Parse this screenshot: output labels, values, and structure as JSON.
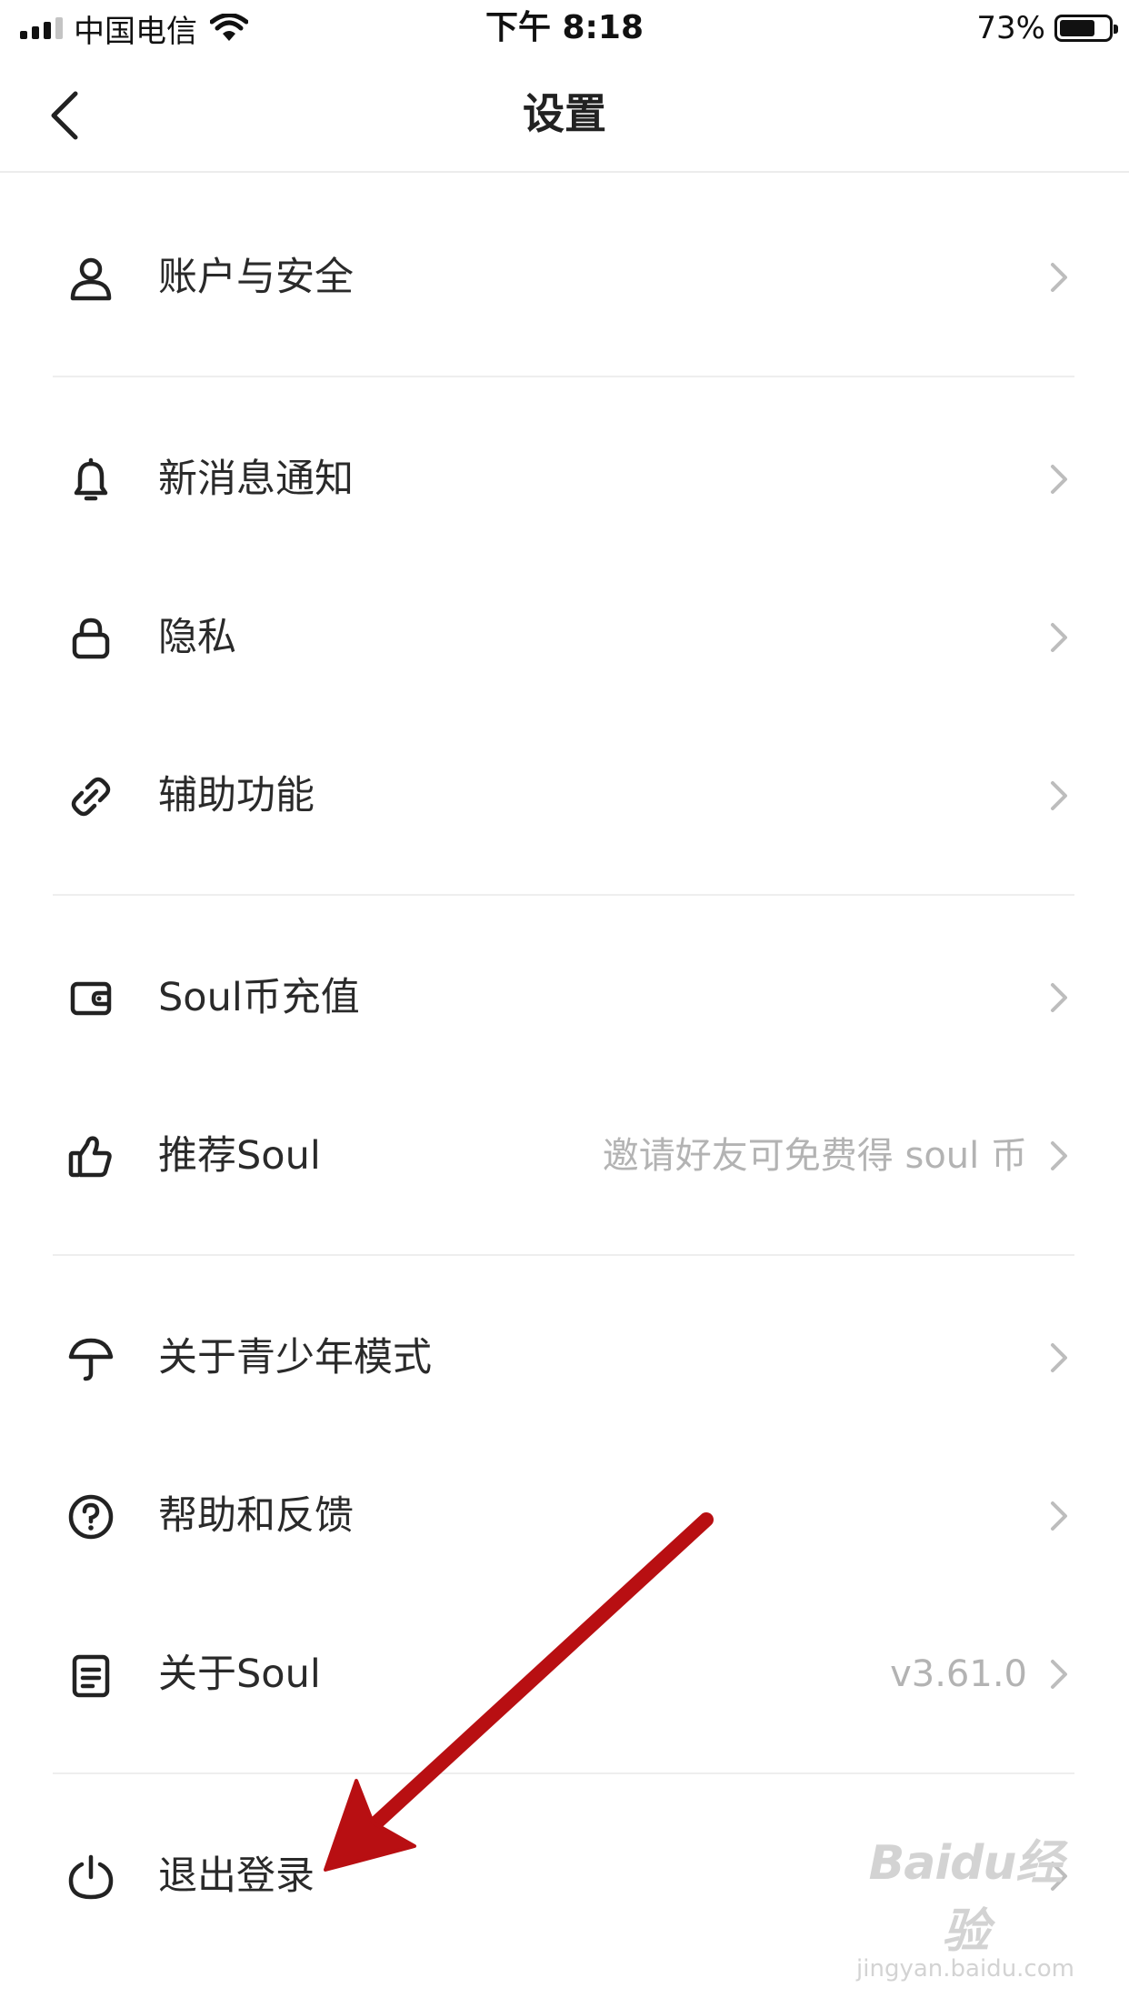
{
  "status_bar": {
    "carrier": "中国电信",
    "time": "下午 8:18",
    "battery": "73%",
    "battery_level": 0.73
  },
  "nav": {
    "title": "设置",
    "back_icon": "chevron-left-icon"
  },
  "items": [
    {
      "label": "账户与安全",
      "value": "",
      "icon": "user-icon"
    },
    {
      "label": "新消息通知",
      "value": "",
      "icon": "bell-icon"
    },
    {
      "label": "隐私",
      "value": "",
      "icon": "lock-icon"
    },
    {
      "label": "辅助功能",
      "value": "",
      "icon": "link-icon"
    },
    {
      "label": "Soul币充值",
      "value": "",
      "icon": "wallet-icon"
    },
    {
      "label": "推荐Soul",
      "value": "邀请好友可免费得 soul 币",
      "icon": "thumbs-up-icon"
    },
    {
      "label": "关于青少年模式",
      "value": "",
      "icon": "umbrella-icon"
    },
    {
      "label": "帮助和反馈",
      "value": "",
      "icon": "help-circle-icon"
    },
    {
      "label": "关于Soul",
      "value": "v3.61.0",
      "icon": "document-icon"
    },
    {
      "label": "退出登录",
      "value": "",
      "icon": "power-icon"
    }
  ],
  "annotation": {
    "arrow_color": "#b80f12"
  },
  "watermark": {
    "logo": "Baidu经验",
    "url": "jingyan.baidu.com"
  }
}
